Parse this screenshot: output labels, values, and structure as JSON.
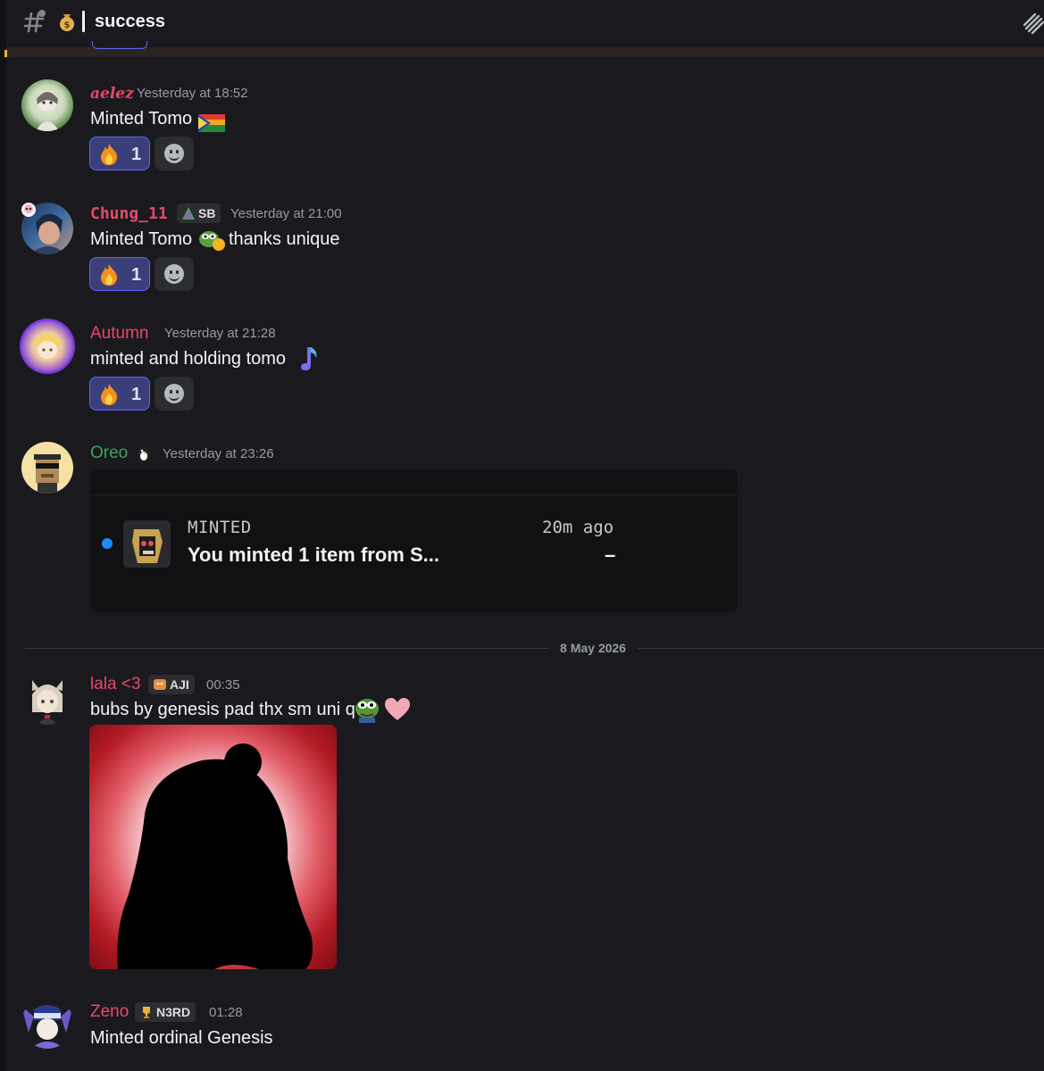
{
  "header": {
    "channel_name": "success",
    "channel_icon": "hashtag-icon",
    "channel_emoji": "money-bag-emoji",
    "threads_icon": "threads-icon"
  },
  "messages": [
    {
      "author": "aelez",
      "author_color": "#e8486b",
      "timestamp": "Yesterday at 18:52",
      "content": "Minted Tomo",
      "content_emoji": "pride-flag-emoji",
      "reaction": {
        "emoji": "fire-emoji",
        "count": "1"
      }
    },
    {
      "author": "Chung_11",
      "author_color": "#e8486b",
      "tag": "SB",
      "timestamp": "Yesterday at 21:00",
      "content_before": "Minted Tomo",
      "content_emoji": "pepe-coin-emoji",
      "content_after": "thanks unique",
      "reaction": {
        "emoji": "fire-emoji",
        "count": "1"
      }
    },
    {
      "author": "Autumn",
      "author_color": "#e8486b",
      "timestamp": "Yesterday at 21:28",
      "content": "minted and holding tomo",
      "content_emoji": "music-note-emoji",
      "reaction": {
        "emoji": "fire-emoji",
        "count": "1"
      }
    },
    {
      "author": "Oreo",
      "author_color": "#3ba55d",
      "author_emoji": "penguin-emoji",
      "timestamp": "Yesterday at 23:26",
      "embed": {
        "kind": "MINTED",
        "time": "20m ago",
        "title": "You minted 1 item from S...",
        "value": "–"
      }
    },
    {
      "author": "lala <3",
      "author_color": "#e8486b",
      "tag": "AJI",
      "timestamp": "00:35",
      "content": "bubs by genesis pad thx sm uni q",
      "content_emojis": [
        "pepe-emoji",
        "pink-heart-emoji"
      ],
      "attachment": "silhouette-image"
    },
    {
      "author": "Zeno",
      "author_color": "#e8486b",
      "tag": "N3RD",
      "timestamp": "01:28",
      "content": "Minted ordinal Genesis"
    }
  ],
  "date_divider": "8 May 2026",
  "colors": {
    "background": "#1a1a1e",
    "reaction_bg": "#3b3f79",
    "reaction_border": "#5865f2",
    "embed_bg": "#111113",
    "timestamp": "#949ba4"
  }
}
